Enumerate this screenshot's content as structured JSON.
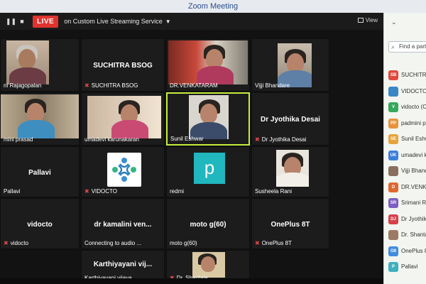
{
  "window": {
    "title": "Zoom Meeting"
  },
  "toolbar": {
    "live_label": "LIVE",
    "stream_label": "on Custom Live Streaming Service",
    "view_label": "View"
  },
  "tiles": [
    {
      "label": "ni Rajagopalan",
      "center": ""
    },
    {
      "label": "SUCHITRA BSOG",
      "center": "SUCHITRA BSOG"
    },
    {
      "label": "DR.VENKATARAM",
      "center": ""
    },
    {
      "label": "Vijji Bhandare",
      "center": ""
    },
    {
      "label": "mini prasad",
      "center": ""
    },
    {
      "label": "umadevi karunakaran",
      "center": ""
    },
    {
      "label": "Sunil Eshwar",
      "center": ""
    },
    {
      "label": "Dr Jyothika Desai",
      "center": "Dr Jyothika Desai"
    },
    {
      "label": "Pallavi",
      "center": "Pallavi"
    },
    {
      "label": "VIDOCTO",
      "center": ""
    },
    {
      "label": "redmi",
      "center": ""
    },
    {
      "label": "Susheela Rani",
      "center": ""
    },
    {
      "label": "vidocto",
      "center": "vidocto"
    },
    {
      "label": "Connecting to audio ...",
      "center": "dr kamalini ven..."
    },
    {
      "label": "moto g(60)",
      "center": "moto g(60)"
    },
    {
      "label": "OnePlus 8T",
      "center": "OnePlus 8T"
    },
    {
      "label": "Karthiyayani vijaya",
      "center": "Karthiyayani vij..."
    },
    {
      "label": "Dr. Shantala",
      "center": ""
    }
  ],
  "redmi_avatar_letter": "p",
  "panel": {
    "search_placeholder": "Find a parti",
    "participants": [
      {
        "initials": "SB",
        "name": "SUCHITRA",
        "color": "#e04a3f"
      },
      {
        "initials": "",
        "name": "VIDOCTO",
        "color": "#3b86c6"
      },
      {
        "initials": "V",
        "name": "vidocto (C",
        "color": "#35a85a"
      },
      {
        "initials": "PP",
        "name": "padmini pr",
        "color": "#e8923a"
      },
      {
        "initials": "SE",
        "name": "Sunil Eshw",
        "color": "#e8a23a"
      },
      {
        "initials": "UK",
        "name": "umadevi k",
        "color": "#3c7fd8"
      },
      {
        "initials": "",
        "name": "Vijji Bhandare",
        "color": "#8a6f5e"
      },
      {
        "initials": "D",
        "name": "DR.VENKAT",
        "color": "#e0672e"
      },
      {
        "initials": "SR",
        "name": "Srimani Raja",
        "color": "#7c5fc0"
      },
      {
        "initials": "DJ",
        "name": "Dr Jyothika",
        "color": "#d8404a"
      },
      {
        "initials": "",
        "name": "Dr. Shantala",
        "color": "#9c7a64"
      },
      {
        "initials": "O8",
        "name": "OnePlus 8T",
        "color": "#3f8de0"
      },
      {
        "initials": "P",
        "name": "Pallavi",
        "color": "#3fb0c0"
      }
    ]
  }
}
